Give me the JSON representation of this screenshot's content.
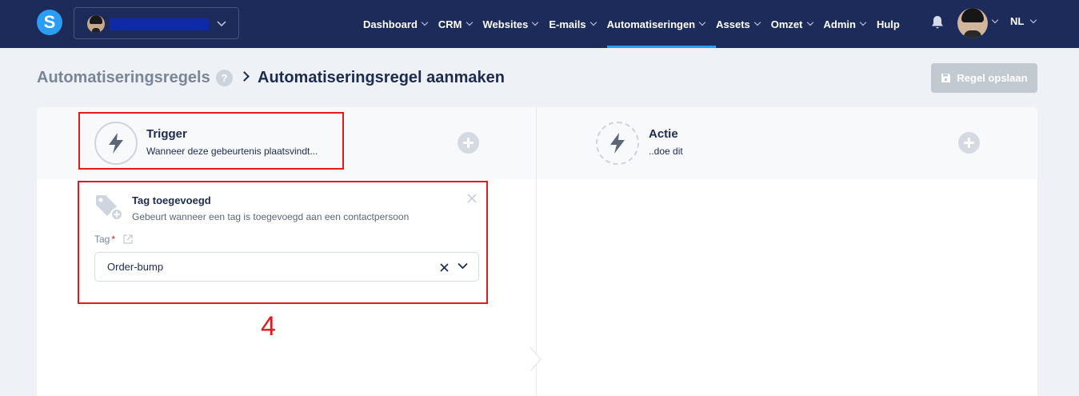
{
  "nav": {
    "items": [
      {
        "label": "Dashboard",
        "active": false
      },
      {
        "label": "CRM",
        "active": false
      },
      {
        "label": "Websites",
        "active": false
      },
      {
        "label": "E-mails",
        "active": false
      },
      {
        "label": "Automatiseringen",
        "active": true
      },
      {
        "label": "Assets",
        "active": false
      },
      {
        "label": "Omzet",
        "active": false
      },
      {
        "label": "Admin",
        "active": false
      },
      {
        "label": "Hulp",
        "active": false
      }
    ],
    "language": "NL",
    "logo": "S",
    "accent_color": "#2a9df4",
    "bar_color": "#1c2b5a"
  },
  "breadcrumb": {
    "parent": "Automatiseringsregels",
    "help": "?",
    "current": "Automatiseringsregel aanmaken"
  },
  "toolbar": {
    "save_label": "Regel opslaan"
  },
  "trigger": {
    "title": "Trigger",
    "subtitle": "Wanneer deze gebeurtenis plaatsvindt..."
  },
  "action": {
    "title": "Actie",
    "subtitle": "..doe dit"
  },
  "trigger_card": {
    "title": "Tag toegevoegd",
    "description": "Gebeurt wanneer een tag is toegevoegd aan een contactpersoon",
    "field_label": "Tag",
    "required_mark": "*",
    "selected_value": "Order-bump"
  },
  "annotation": {
    "step_number": "4",
    "color": "#e01b1b"
  }
}
